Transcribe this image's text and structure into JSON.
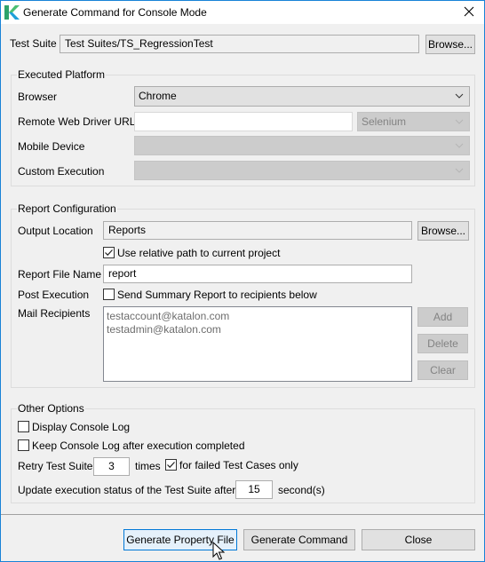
{
  "window": {
    "title": "Generate Command for Console Mode",
    "logo_icon": "katalon-logo-icon",
    "close_icon": "close-icon"
  },
  "test_suite": {
    "label": "Test Suite",
    "value": "Test Suites/TS_RegressionTest",
    "browse_label": "Browse..."
  },
  "executed_platform": {
    "title": "Executed Platform",
    "browser": {
      "label": "Browser",
      "value": "Chrome"
    },
    "remote_web_driver": {
      "label": "Remote Web Driver URL",
      "value": "",
      "type_value": "Selenium"
    },
    "mobile_device": {
      "label": "Mobile Device",
      "value": ""
    },
    "custom_execution": {
      "label": "Custom Execution",
      "value": ""
    }
  },
  "report_configuration": {
    "title": "Report Configuration",
    "output_location": {
      "label": "Output Location",
      "value": "Reports",
      "browse_label": "Browse..."
    },
    "relative_path": {
      "label": "Use relative path to current project",
      "checked": true
    },
    "report_file_name": {
      "label": "Report File Name",
      "value": "report"
    },
    "post_execution": {
      "label": "Post Execution",
      "checkbox_label": "Send Summary Report to recipients below",
      "checked": false
    },
    "mail_recipients": {
      "label": "Mail Recipients",
      "items": [
        "testaccount@katalon.com",
        "testadmin@katalon.com"
      ],
      "add_label": "Add",
      "delete_label": "Delete",
      "clear_label": "Clear"
    }
  },
  "other_options": {
    "title": "Other Options",
    "display_console_log": {
      "label": "Display Console Log",
      "checked": false
    },
    "keep_console_log": {
      "label": "Keep Console Log after execution completed",
      "checked": false
    },
    "retry": {
      "label": "Retry Test Suite",
      "value": "3",
      "unit": "times",
      "failed_only_label": "for failed Test Cases only",
      "failed_only_checked": true
    },
    "update_status": {
      "label": "Update execution status of the Test Suite after",
      "value": "15",
      "unit": "second(s)"
    }
  },
  "footer": {
    "generate_property_file_label": "Generate Property File",
    "generate_command_label": "Generate Command",
    "close_label": "Close"
  }
}
